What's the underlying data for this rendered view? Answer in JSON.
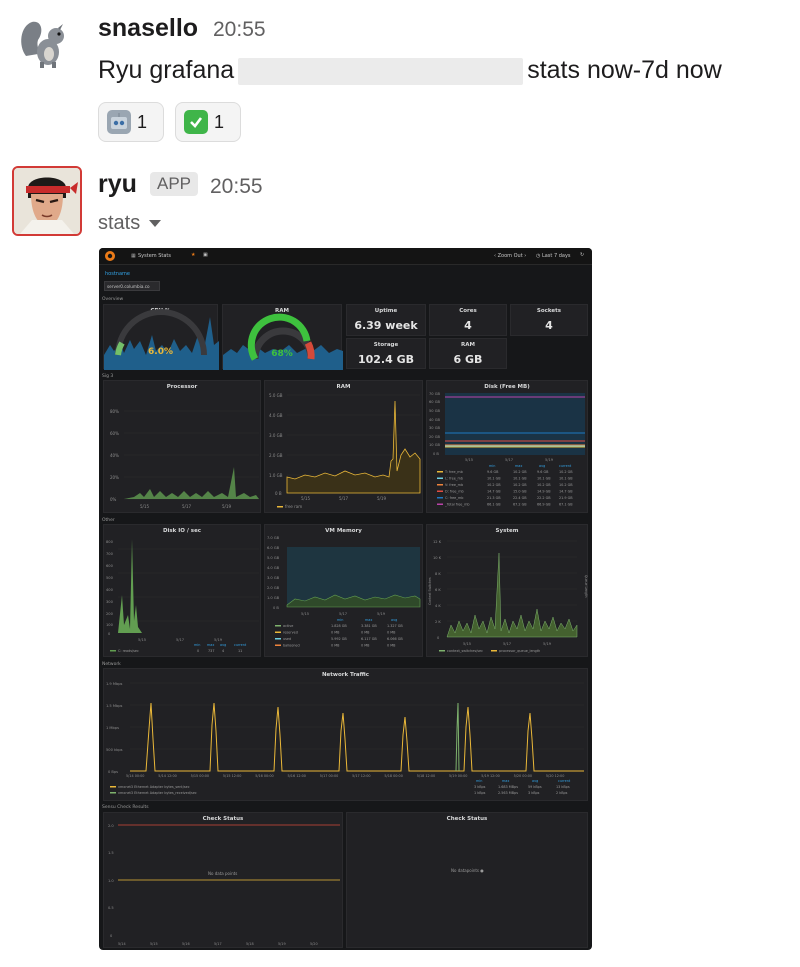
{
  "message1": {
    "sender": "snasello",
    "time": "20:55",
    "text_before": "Ryu grafana",
    "text_after": "stats now-7d now",
    "reactions": [
      {
        "emoji": "robot-emoji",
        "count": "1"
      },
      {
        "emoji": "check-mark-emoji",
        "count": "1"
      }
    ]
  },
  "message2": {
    "sender": "ryu",
    "badge": "APP",
    "time": "20:55",
    "attachment_title": "stats"
  },
  "grafana": {
    "dashboard_title": "System Stats",
    "zoom_out": "Zoom Out",
    "time_range": "Last 7 days",
    "var_label": "hostname",
    "var_value": "server0.columbia.co",
    "rows": [
      "Overview",
      "Sig 3",
      "Other",
      "Network",
      "Sensu Check Results"
    ],
    "collapse": "Collapse",
    "cpu": {
      "title": "CPU %",
      "value": "6.0%"
    },
    "ram_gauge": {
      "title": "RAM",
      "value": "68%"
    },
    "uptime": {
      "title": "Uptime",
      "value": "6.39 week"
    },
    "cores": {
      "title": "Cores",
      "value": "4"
    },
    "sockets": {
      "title": "Sockets",
      "value": "4"
    },
    "storage": {
      "title": "Storage",
      "value": "102.4 GB"
    },
    "ram_stat": {
      "title": "RAM",
      "value": "6 GB"
    },
    "processor": {
      "title": "Processor",
      "yticks": [
        "80%",
        "60%",
        "40%",
        "20%",
        "0%"
      ],
      "xticks": [
        "5/15",
        "5/17",
        "5/19"
      ]
    },
    "ram_graph": {
      "title": "RAM",
      "yticks": [
        "5.0 GB",
        "4.0 GB",
        "3.0 GB",
        "2.0 GB",
        "1.0 GB",
        "0 B"
      ],
      "xticks": [
        "5/15",
        "5/17",
        "5/19"
      ],
      "legend": "free ram"
    },
    "disk_free": {
      "title": "Disk (Free MB)",
      "yticks": [
        "70 GB",
        "60 GB",
        "50 GB",
        "40 GB",
        "30 GB",
        "20 GB",
        "10 GB",
        "0 B"
      ],
      "xticks": [
        "5/15",
        "5/17",
        "5/19"
      ],
      "cols": [
        "min",
        "max",
        "avg",
        "current"
      ],
      "legend": [
        {
          "name": "T: free_mb",
          "color": "#eab839",
          "vals": [
            "9.6 GB",
            "10.2 GB",
            "9.6 GB",
            "10.2 GB"
          ]
        },
        {
          "name": "L: free_mb",
          "color": "#6ed0e0",
          "vals": [
            "10.1 GB",
            "10.1 GB",
            "10.1 GB",
            "10.1 GB"
          ]
        },
        {
          "name": "V: free_mb",
          "color": "#ef843c",
          "vals": [
            "10.2 GB",
            "10.2 GB",
            "10.2 GB",
            "10.2 GB"
          ]
        },
        {
          "name": "D: free_mb",
          "color": "#e24d42",
          "vals": [
            "14.7 GB",
            "15.0 GB",
            "14.9 GB",
            "14.7 GB"
          ]
        },
        {
          "name": "C: free_mb",
          "color": "#1f78c1",
          "vals": [
            "21.3 GB",
            "22.4 GB",
            "22.2 GB",
            "21.9 GB"
          ]
        },
        {
          "name": "_Total free_mb",
          "color": "#ba43a9",
          "vals": [
            "66.1 GB",
            "67.2 GB",
            "66.9 GB",
            "67.1 GB"
          ]
        }
      ]
    },
    "diskio": {
      "title": "Disk IO / sec",
      "yticks": [
        "800",
        "700",
        "600",
        "500",
        "400",
        "300",
        "200",
        "100",
        "0"
      ],
      "xticks": [
        "5/15",
        "5/17",
        "5/19"
      ],
      "cols": [
        "min",
        "max",
        "avg",
        "current"
      ],
      "legend": "C: reads/sec",
      "vals": [
        "0",
        "737",
        "4",
        "11"
      ]
    },
    "vmem": {
      "title": "VM Memory",
      "yticks": [
        "7.0 GB",
        "6.0 GB",
        "5.0 GB",
        "4.0 GB",
        "3.0 GB",
        "2.0 GB",
        "1.0 GB",
        "0 B"
      ],
      "xticks": [
        "5/15",
        "5/17",
        "5/19"
      ],
      "cols": [
        "min",
        "max",
        "avg"
      ],
      "legend": [
        {
          "name": "active",
          "vals": [
            "1.828 GB",
            "3.381 GB",
            "1.327 GB"
          ]
        },
        {
          "name": "reserved",
          "vals": [
            "0 MB",
            "0 MB",
            "0 MB"
          ]
        },
        {
          "name": "used",
          "vals": [
            "5.992 GB",
            "6.117 GB",
            "6.066 GB"
          ]
        },
        {
          "name": "ballooned",
          "vals": [
            "0 MB",
            "0 MB",
            "0 MB"
          ]
        }
      ]
    },
    "system": {
      "title": "System",
      "yticks": [
        "12 K",
        "10 K",
        "8 K",
        "6 K",
        "4 K",
        "2 K",
        "0"
      ],
      "xticks": [
        "5/15",
        "5/17",
        "5/19"
      ],
      "ylabel_left": "Context Switches",
      "ylabel_right": "Queue Length",
      "legend": [
        "context_switches/sec",
        "processor_queue_length"
      ]
    },
    "network": {
      "title": "Network Traffic",
      "yticks": [
        "1.9 Mbps",
        "1.5 Mbps",
        "1 Mbps",
        "500 kbps",
        "0 Bps"
      ],
      "xticks": [
        "5/14 00:00",
        "5/14 12:00",
        "5/15 00:00",
        "5/15 12:00",
        "5/16 00:00",
        "5/16 12:00",
        "5/17 00:00",
        "5/17 12:00",
        "5/18 00:00",
        "5/18 12:00",
        "5/19 00:00",
        "5/19 12:00",
        "5/20 00:00",
        "5/20 12:00"
      ],
      "cols": [
        "min",
        "max",
        "avg",
        "current"
      ],
      "legend": [
        {
          "name": "vmxnet3 Ethernet Adapter bytes_sent/sec",
          "vals": [
            "3 kBps",
            "1.683 MBps",
            "59 kBps",
            "13 kBps"
          ]
        },
        {
          "name": "vmxnet3 Ethernet Adapter bytes_received/sec",
          "vals": [
            "1 kBps",
            "2.563 MBps",
            "3 kBps",
            "2 kBps"
          ]
        }
      ]
    },
    "check1": {
      "title": "Check Status",
      "yticks": [
        "2.0",
        "1.5",
        "1.0",
        "0.5",
        "0"
      ],
      "xticks": [
        "5/14",
        "5/15",
        "5/16",
        "5/17",
        "5/18",
        "5/19",
        "5/20"
      ],
      "nodata": "No data points"
    },
    "check2": {
      "title": "Check Status",
      "nodata": "No datapoints"
    }
  }
}
